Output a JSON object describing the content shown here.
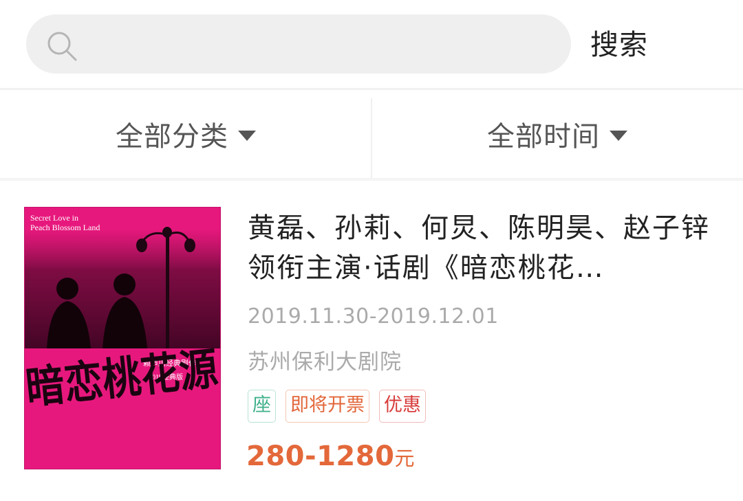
{
  "search": {
    "placeholder": "",
    "button_label": "搜索",
    "icon": "search-icon"
  },
  "filters": {
    "category_label": "全部分类",
    "time_label": "全部时间",
    "dropdown_icon": "caret-down-icon"
  },
  "event": {
    "title": "黄磊、孙莉、何炅、陈明昊、赵子锌领衔主演·话剧《暗恋桃花…",
    "date_range": "2019.11.30-2019.12.01",
    "venue": "苏州保利大剧院",
    "tags": [
      "座",
      "即将开票",
      "优惠"
    ],
    "price": "280-1280",
    "price_unit": "元",
    "poster": {
      "english_title_line1": "Secret Love in",
      "english_title_line2": "Peach Blossom Land",
      "director_credit": "赖声川经典剧作",
      "edition": "2019经典版",
      "calligraphy_title": "暗恋桃花源",
      "background_color": "#e7187d"
    }
  },
  "colors": {
    "price": "#e3683a",
    "tag_seat": "#3fb08c",
    "tag_sale": "#e2663a",
    "tag_promo": "#d83b3b"
  }
}
